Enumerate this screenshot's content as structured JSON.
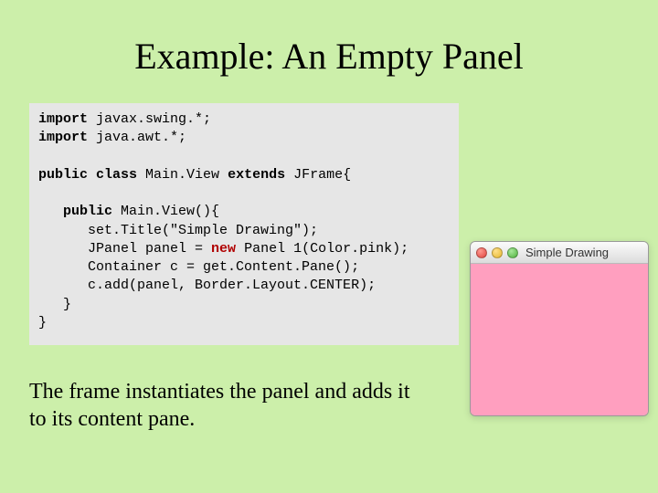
{
  "title": "Example: An Empty Panel",
  "code": {
    "l1a": "import",
    "l1b": " javax.swing.*;",
    "l2a": "import",
    "l2b": " java.awt.*;",
    "l3a": "public",
    "l3b": " class",
    "l3c": " Main.View ",
    "l3d": "extends",
    "l3e": " JFrame{",
    "l4a": "public",
    "l4b": " Main.View(){",
    "l5": "set.Title(\"Simple Drawing\");",
    "l6a": "JPanel panel = ",
    "l6b": "new",
    "l6c": " Panel 1(Color.pink);",
    "l7": "Container c = get.Content.Pane();",
    "l8": "c.add(panel, Border.Layout.CENTER);",
    "l9": "}",
    "l10": "}"
  },
  "caption_line1": "The frame instantiates the panel and adds it",
  "caption_line2": "to its content pane.",
  "window": {
    "title": "Simple Drawing",
    "content_color": "#ff9fbf"
  }
}
